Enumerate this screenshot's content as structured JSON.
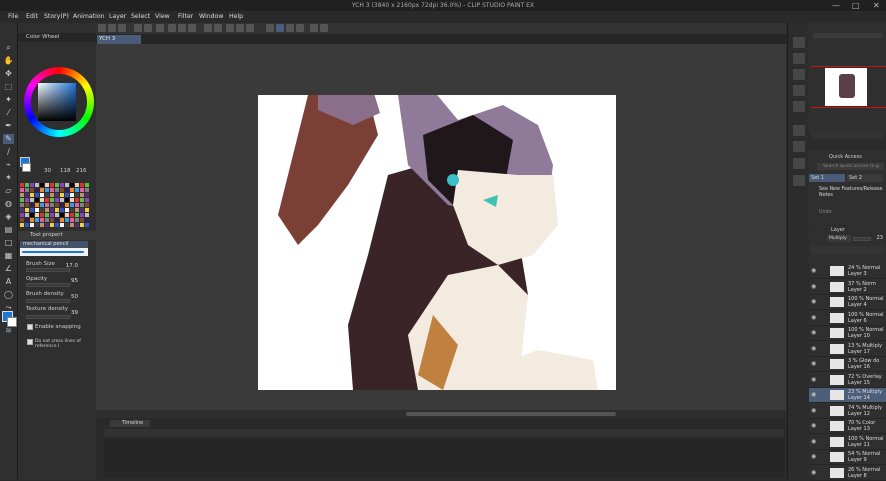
{
  "window": {
    "title": "YCH 3 (3840 x 2160px 72dpi 36.0%) - CLIP STUDIO PAINT EX",
    "controls": [
      "—",
      "□",
      "✕"
    ]
  },
  "menu": [
    "File",
    "Edit",
    "Story(P)",
    "Animation",
    "Layer",
    "Select",
    "View",
    "Filter",
    "Window",
    "Help"
  ],
  "tabs": {
    "active": "YCH 3"
  },
  "color_panel": {
    "title": "Color Wheel",
    "values": [
      "30",
      "118",
      "216"
    ],
    "main_color": "#1e76d8"
  },
  "tool_property": {
    "tab_label": "Tool propert",
    "tool_name": "mechanical pencil",
    "brush_size_label": "Brush Size",
    "brush_size_value": "17.0",
    "opacity_label": "Opacity",
    "opacity_value": "95",
    "brush_density_label": "Brush density",
    "brush_density_value": "50",
    "texture_density_label": "Texture density",
    "texture_density_value": "39",
    "enable_snapping": "Enable snapping",
    "do_not_cross": "Do not cross lines of reference l"
  },
  "timeline": {
    "title": "Timeline"
  },
  "quick_access": {
    "title": "Quick Access",
    "search_placeholder": "Search quick access (e.g.",
    "set1": "Set 1",
    "set2": "Set 2",
    "item1": "See New Features/Release Notes",
    "undo": "Undo"
  },
  "layer_panel": {
    "title": "Layer",
    "blend_mode": "Multiply",
    "opacity": "23",
    "layers": [
      {
        "mode": "24 % Normal",
        "name": "Layer 3",
        "selected": false
      },
      {
        "mode": "37 % Norm",
        "name": "Layer 2",
        "selected": false
      },
      {
        "mode": "100 % Normal",
        "name": "Layer 4",
        "selected": false
      },
      {
        "mode": "100 % Normal",
        "name": "Layer 6",
        "selected": false
      },
      {
        "mode": "100 % Normal",
        "name": "Layer 10",
        "selected": false
      },
      {
        "mode": "13 % Multiply",
        "name": "Layer 17",
        "selected": false
      },
      {
        "mode": "3 % Glow do",
        "name": "Layer 16",
        "selected": false
      },
      {
        "mode": "72 % Overlay",
        "name": "Layer 15",
        "selected": false
      },
      {
        "mode": "23 % Multiply",
        "name": "Layer 14",
        "selected": true
      },
      {
        "mode": "74 % Multiply",
        "name": "Layer 12",
        "selected": false
      },
      {
        "mode": "70 % Color",
        "name": "Layer 13",
        "selected": false
      },
      {
        "mode": "100 % Normal",
        "name": "Layer 11",
        "selected": false
      },
      {
        "mode": "54 % Normal",
        "name": "Layer 9",
        "selected": false
      },
      {
        "mode": "26 % Normal",
        "name": "Layer 8",
        "selected": false
      }
    ]
  }
}
